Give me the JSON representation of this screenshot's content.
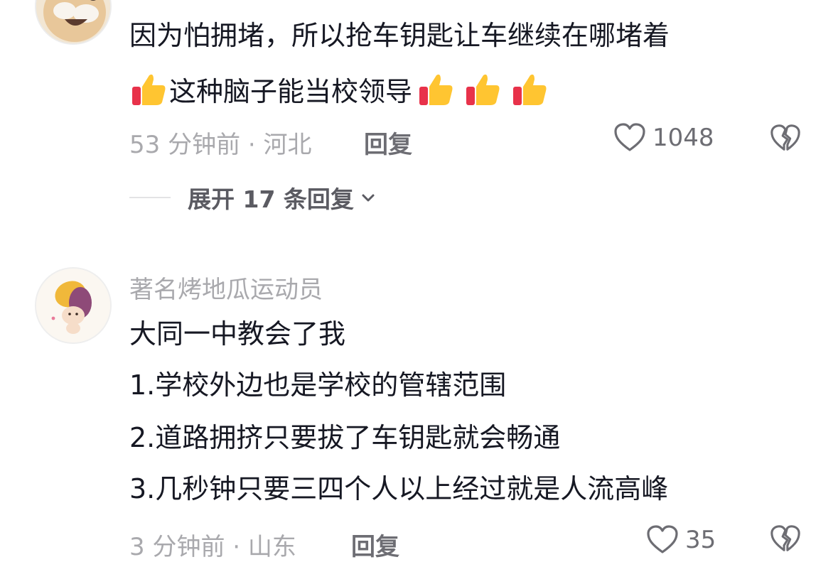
{
  "comment1": {
    "text_line1": "因为怕拥堵，所以抢车钥匙让车继续在哪堵着",
    "text_line2": "这种脑子能当校领导",
    "time_location": "53 分钟前 · 河北",
    "reply_label": "回复",
    "like_count": "1048",
    "expand_label": "展开 17 条回复",
    "emoji_icon": "thumbs-up-emoji"
  },
  "comment2": {
    "username": "著名烤地瓜运动员",
    "lines": [
      "大同一中教会了我",
      "1.学校外边也是学校的管辖范围",
      "2.道路拥挤只要拔了车钥匙就会畅通",
      "3.几秒钟只要三四个人以上经过就是人流高峰"
    ],
    "time_location": "3 分钟前 · 山东",
    "reply_label": "回复",
    "like_count": "35"
  }
}
